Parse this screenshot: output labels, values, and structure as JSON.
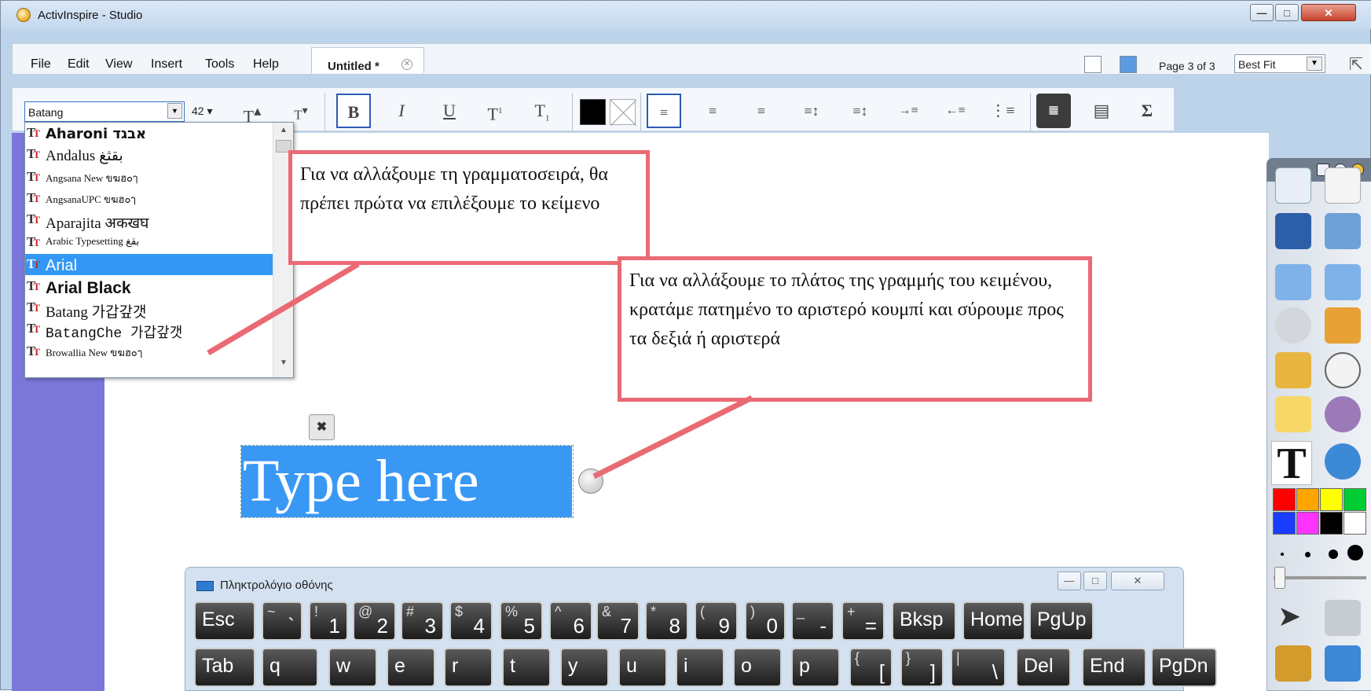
{
  "window": {
    "title": "ActivInspire - Studio"
  },
  "menu": [
    "File",
    "Edit",
    "View",
    "Insert",
    "Tools",
    "Help"
  ],
  "tab": {
    "label": "Untitled *"
  },
  "page_indicator": "Page 3 of 3",
  "zoom": "Best Fit",
  "font": {
    "current": "Batang",
    "size": "42"
  },
  "font_list": [
    {
      "name": "Aharoni",
      "sample": "אבגד",
      "style": "bold"
    },
    {
      "name": "Andalus",
      "sample": "بقثغ",
      "style": "serif"
    },
    {
      "name": "Angsana New",
      "sample": "ขฆฮ๐ๅ",
      "style": "small"
    },
    {
      "name": "AngsanaUPC",
      "sample": "ขฆฮ๐ๅ",
      "style": "small"
    },
    {
      "name": "Aparajita",
      "sample": "अकखघ",
      "style": "serif"
    },
    {
      "name": "Arabic Typesetting",
      "sample": "بقغ",
      "style": "small"
    },
    {
      "name": "Arial",
      "sample": "",
      "style": "selected"
    },
    {
      "name": "Arial Black",
      "sample": "",
      "style": "black"
    },
    {
      "name": "Batang",
      "sample": "가갑갚갯",
      "style": "normal"
    },
    {
      "name": "BatangChe",
      "sample": "가갑갚갯",
      "style": "mono"
    },
    {
      "name": "Browallia New",
      "sample": "ขฆฮ๐ๅ",
      "style": "small"
    }
  ],
  "callouts": {
    "font": "Για να αλλάξουμε τη γραμματοσειρά, θα πρέπει πρώτα να επιλέξουμε το κείμενο",
    "width": "Για να αλλάξουμε το πλάτος της γραμμής του κειμένου, κρατάμε πατημένο το αριστερό κουμπί και σύρουμε προς τα δεξιά ή αριστερά"
  },
  "textbox": {
    "text": "Type here"
  },
  "keyboard": {
    "title": "Πληκτρολόγιο οθόνης",
    "row1": [
      {
        "main": "Esc"
      },
      {
        "top": "~",
        "bottom": "`"
      },
      {
        "top": "!",
        "bottom": "1"
      },
      {
        "top": "@",
        "bottom": "2"
      },
      {
        "top": "#",
        "bottom": "3"
      },
      {
        "top": "$",
        "bottom": "4"
      },
      {
        "top": "%",
        "bottom": "5"
      },
      {
        "top": "^",
        "bottom": "6"
      },
      {
        "top": "&",
        "bottom": "7"
      },
      {
        "top": "*",
        "bottom": "8"
      },
      {
        "top": "(",
        "bottom": "9"
      },
      {
        "top": ")",
        "bottom": "0"
      },
      {
        "top": "_",
        "bottom": "-"
      },
      {
        "top": "+",
        "bottom": "="
      },
      {
        "main": "Bksp"
      },
      {
        "main": "Home"
      },
      {
        "main": "PgUp"
      }
    ],
    "row2": [
      {
        "main": "Tab"
      },
      {
        "main": "q"
      },
      {
        "main": "w"
      },
      {
        "main": "e"
      },
      {
        "main": "r"
      },
      {
        "main": "t"
      },
      {
        "main": "y"
      },
      {
        "main": "u"
      },
      {
        "main": "i"
      },
      {
        "main": "o"
      },
      {
        "main": "p"
      },
      {
        "top": "{",
        "bottom": "["
      },
      {
        "top": "}",
        "bottom": "]"
      },
      {
        "top": "|",
        "bottom": "\\"
      },
      {
        "main": "Del"
      },
      {
        "main": "End"
      },
      {
        "main": "PgDn"
      }
    ]
  },
  "palette": [
    "#ff0000",
    "#ffa500",
    "#ffff00",
    "#00cc33",
    "#1a3cff",
    "#ff33ff",
    "#000000",
    "#ffffff"
  ],
  "colors": {
    "callout_border": "#ea6a74",
    "selection": "#3a98f5",
    "left_strip": "#7b77d8"
  }
}
